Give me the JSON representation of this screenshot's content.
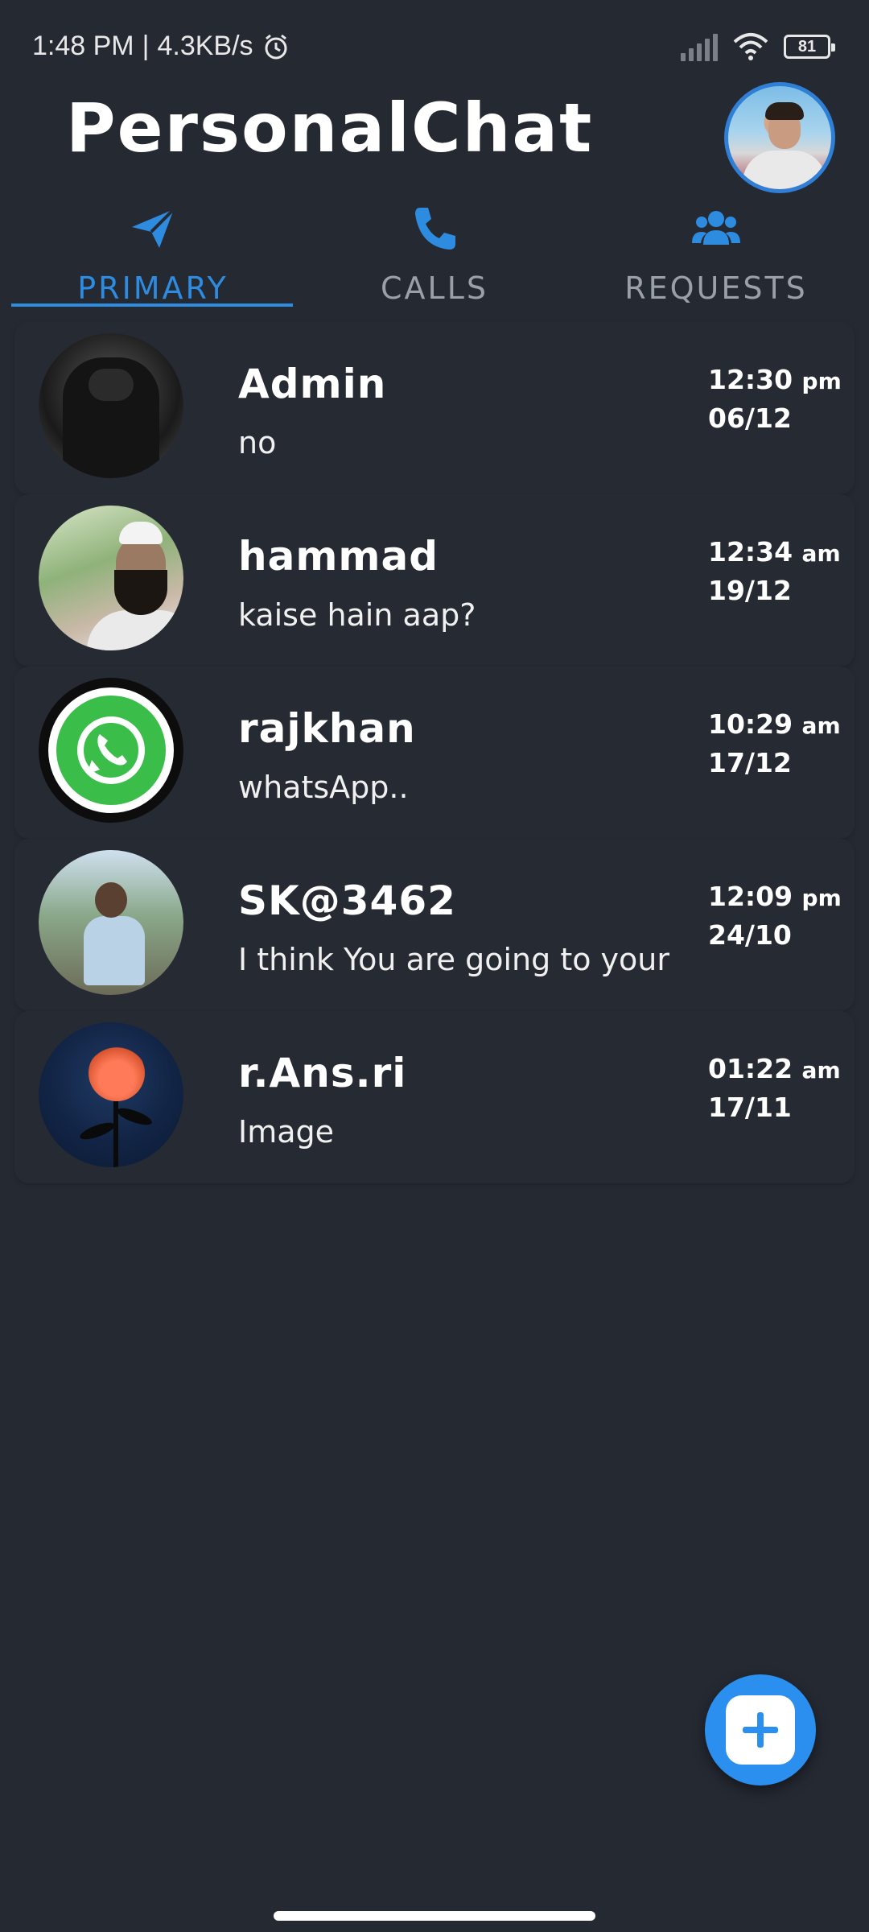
{
  "status_bar": {
    "time": "1:48 PM",
    "separator": "|",
    "network_speed": "4.3KB/s",
    "battery": "81",
    "icons": [
      "alarm-icon",
      "signal-icon",
      "wifi-icon",
      "battery-icon"
    ]
  },
  "header": {
    "title": "PersonalChat"
  },
  "tabs": [
    {
      "label": "PRIMARY",
      "icon": "send-icon",
      "active": true
    },
    {
      "label": "CALLS",
      "icon": "phone-icon",
      "active": false
    },
    {
      "label": "REQUESTS",
      "icon": "users-icon",
      "active": false
    }
  ],
  "chats": [
    {
      "name": "Admin",
      "message": "no",
      "time": "12:30",
      "ampm": "pm",
      "date": "06/12"
    },
    {
      "name": "hammad",
      "message": "kaise hain aap?",
      "time": "12:34",
      "ampm": "am",
      "date": "19/12"
    },
    {
      "name": "rajkhan",
      "message": "whatsApp..",
      "time": "10:29",
      "ampm": "am",
      "date": "17/12"
    },
    {
      "name": "SK@3462",
      "message": "I think You are going to your",
      "time": "12:09",
      "ampm": "pm",
      "date": "24/10"
    },
    {
      "name": "r.Ans.ri",
      "message": "Image",
      "time": "01:22",
      "ampm": "am",
      "date": "17/11"
    }
  ],
  "colors": {
    "background": "#252932",
    "accent": "#2d8be0",
    "inactive_tab": "#9aa0a8"
  },
  "fab": {
    "icon": "plus-icon"
  }
}
